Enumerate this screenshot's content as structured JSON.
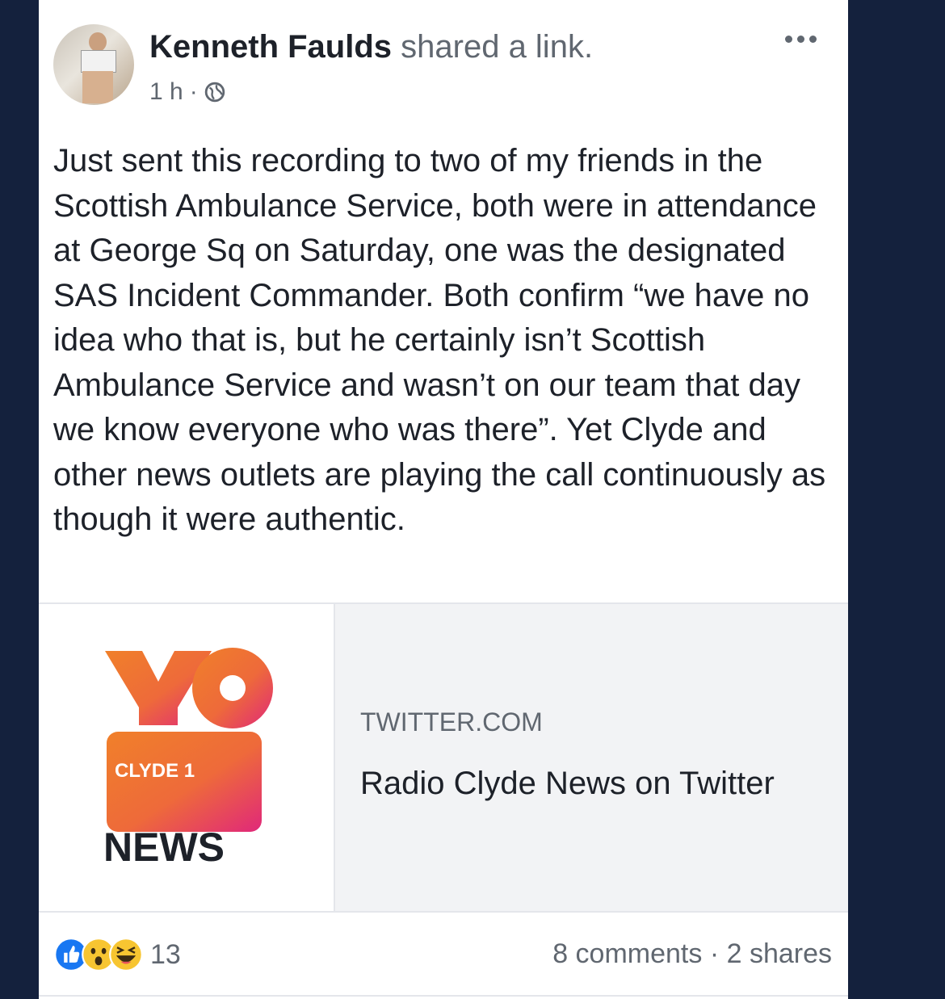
{
  "post": {
    "author_name": "Kenneth Faulds",
    "action": " shared a link.",
    "time": "1 h",
    "separator": "·",
    "privacy_icon": "globe-icon",
    "more_icon": "more-options-icon",
    "body": "Just sent this recording to two of my friends in the Scottish Ambulance Service, both were in attendance at George Sq on Saturday, one was the designated SAS Incident Commander. Both confirm “we have no idea who that is, but he certainly isn’t Scottish Ambulance Service and wasn’t on our team that day we know everyone who was there”.  Yet Clyde and other news outlets are playing the call continuously as though it were authentic."
  },
  "link": {
    "logo_line1": "CLYDE 1",
    "logo_line2": "NEWS",
    "domain": "TWITTER.COM",
    "title": "Radio Clyde News on Twitter"
  },
  "footer": {
    "reaction_icons": [
      "like-icon",
      "wow-icon",
      "haha-icon"
    ],
    "reaction_count": "13",
    "comments": "8 comments",
    "dot": " · ",
    "shares": "2 shares"
  },
  "colors": {
    "background": "#14213d",
    "card": "#ffffff",
    "text_primary": "#1d2129",
    "text_secondary": "#606770",
    "like_blue": "#1877f2",
    "logo_orange": "#f0802a",
    "logo_pink": "#e0287a"
  }
}
